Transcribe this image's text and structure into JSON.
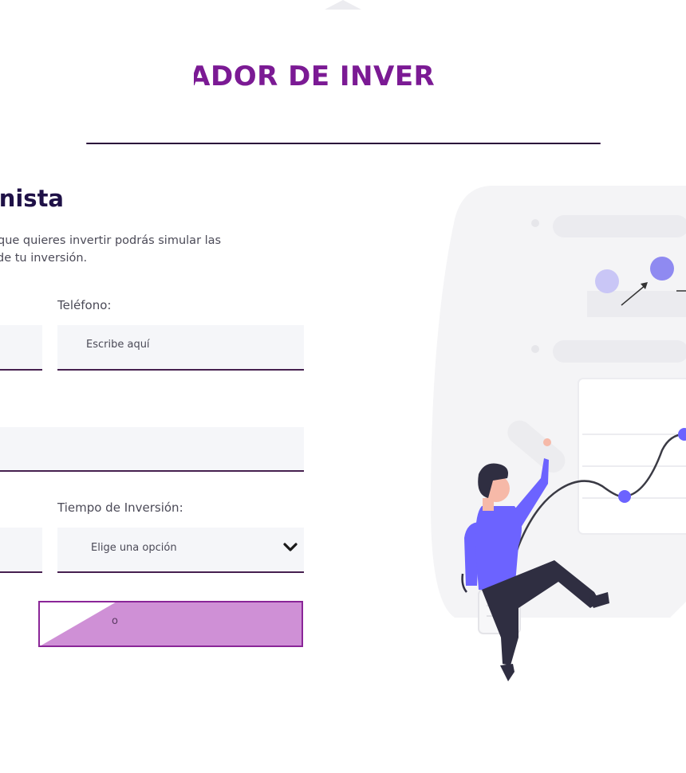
{
  "header": {
    "title": "LADOR DE INVER"
  },
  "section": {
    "title": "nista",
    "description_line1": "que quieres invertir podrás simular las",
    "description_line2": "de tu inversión."
  },
  "form": {
    "phone_label": "Teléfono:",
    "phone_placeholder": "Escribe aquí",
    "time_label": "Tiempo de Inversión:",
    "time_placeholder": "Elige una opción",
    "submit_label": "o"
  },
  "icons": {
    "dropdown": "chevron-down-icon",
    "illustration": "investment-growth-illustration"
  },
  "colors": {
    "brand_purple": "#7b1a94",
    "button_fill": "#cf90d6",
    "button_border": "#8a2598",
    "field_bg": "#f5f6f9",
    "field_border": "#46204f",
    "accent_violet": "#6c63ff"
  }
}
